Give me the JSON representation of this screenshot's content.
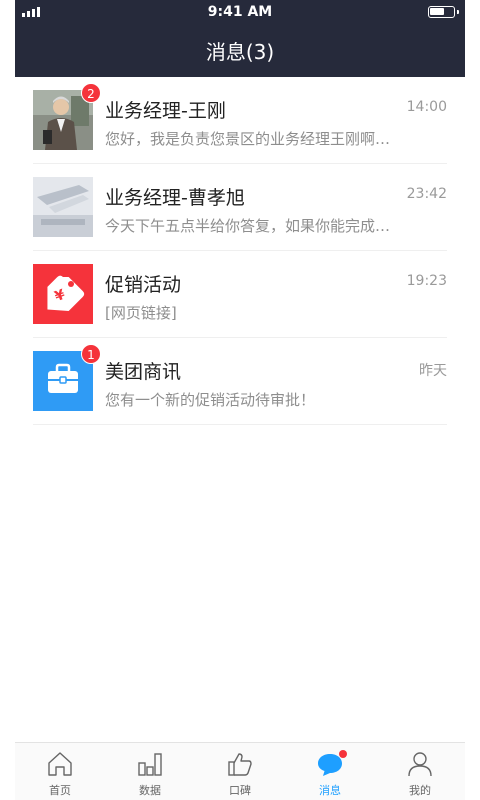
{
  "status_bar": {
    "time": "9:41 AM",
    "battery_level": 0.55
  },
  "header": {
    "title": "消息(3)"
  },
  "messages": [
    {
      "name": "业务经理-王刚",
      "time": "14:00",
      "preview": "您好，我是负责您景区的业务经理王刚啊…",
      "badge": "2",
      "avatar": "person-photo"
    },
    {
      "name": "业务经理-曹孝旭",
      "time": "23:42",
      "preview": "今天下午五点半给你答复，如果你能完成…",
      "badge": "",
      "avatar": "office-photo"
    },
    {
      "name": "促销活动",
      "time": "19:23",
      "preview": "[网页链接]",
      "badge": "",
      "avatar": "tag-icon",
      "avatar_color": "#f5333b"
    },
    {
      "name": "美团商讯",
      "time": "昨天",
      "preview": "您有一个新的促销活动待审批！",
      "badge": "1",
      "avatar": "briefcase-icon",
      "avatar_color": "#2f9bf5"
    }
  ],
  "tabbar": {
    "items": [
      {
        "label": "首页",
        "icon": "home-icon"
      },
      {
        "label": "数据",
        "icon": "bar-chart-icon"
      },
      {
        "label": "口碑",
        "icon": "thumbs-up-icon"
      },
      {
        "label": "消息",
        "icon": "chat-bubble-icon",
        "active": true
      },
      {
        "label": "我的",
        "icon": "user-icon"
      }
    ],
    "accent": "#1e9fff"
  }
}
